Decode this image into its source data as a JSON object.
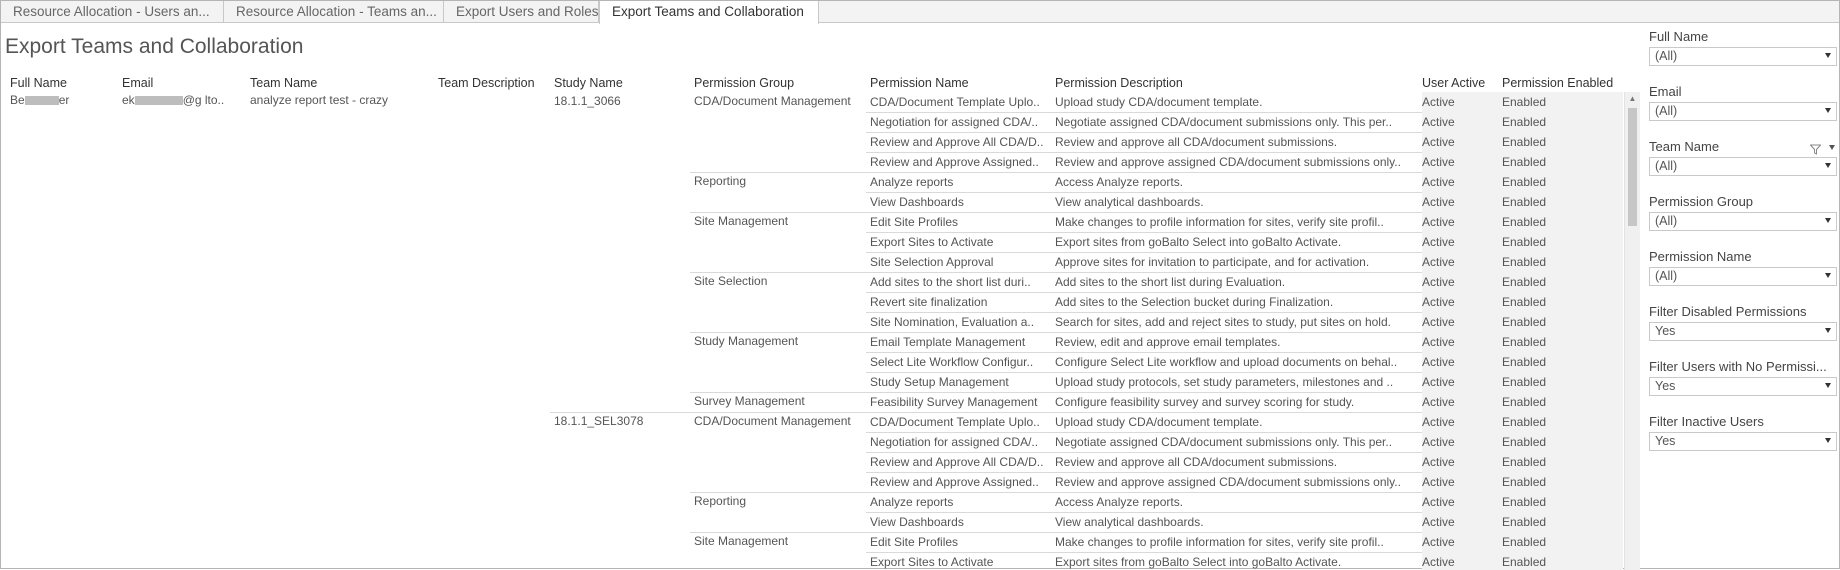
{
  "tabs": [
    {
      "label": "Resource Allocation - Users an...",
      "active": false
    },
    {
      "label": "Resource Allocation - Teams an...",
      "active": false
    },
    {
      "label": "Export Users and Roles",
      "active": false
    },
    {
      "label": "Export Teams and Collaboration",
      "active": true
    }
  ],
  "page_title": "Export Teams and Collaboration",
  "columns": [
    "Full Name",
    "Email",
    "Team Name",
    "Team Description",
    "Study Name",
    "Permission Group",
    "Permission Name",
    "Permission Description",
    "User Active",
    "Permission Enabled"
  ],
  "user": {
    "full_name_start": "Be",
    "full_name_end": "er",
    "email_start": "ek",
    "email_end": "@g   lto..",
    "team_name": "analyze report test - crazy",
    "team_description": ""
  },
  "studies": [
    {
      "name": "18.1.1_3066",
      "groups": [
        {
          "name": "CDA/Document Management",
          "rows": [
            {
              "perm": "CDA/Document Template Uplo..",
              "desc": "Upload study CDA/document template.",
              "active": "Active",
              "enabled": "Enabled"
            },
            {
              "perm": "Negotiation for assigned CDA/..",
              "desc": "Negotiate assigned CDA/document submissions only. This per..",
              "active": "Active",
              "enabled": "Enabled"
            },
            {
              "perm": "Review and Approve All CDA/D..",
              "desc": "Review and approve all CDA/document submissions.",
              "active": "Active",
              "enabled": "Enabled"
            },
            {
              "perm": "Review and Approve Assigned..",
              "desc": "Review and approve assigned CDA/document submissions only..",
              "active": "Active",
              "enabled": "Enabled"
            }
          ]
        },
        {
          "name": "Reporting",
          "rows": [
            {
              "perm": "Analyze reports",
              "desc": "Access Analyze reports.",
              "active": "Active",
              "enabled": "Enabled"
            },
            {
              "perm": "View Dashboards",
              "desc": "View analytical dashboards.",
              "active": "Active",
              "enabled": "Enabled"
            }
          ]
        },
        {
          "name": "Site Management",
          "rows": [
            {
              "perm": "Edit Site Profiles",
              "desc": "Make changes to profile information for sites, verify site profil..",
              "active": "Active",
              "enabled": "Enabled"
            },
            {
              "perm": "Export Sites to Activate",
              "desc": "Export sites from goBalto Select into goBalto Activate.",
              "active": "Active",
              "enabled": "Enabled"
            },
            {
              "perm": "Site Selection Approval",
              "desc": "Approve sites for invitation to participate, and for activation.",
              "active": "Active",
              "enabled": "Enabled"
            }
          ]
        },
        {
          "name": "Site Selection",
          "rows": [
            {
              "perm": "Add sites to the short list duri..",
              "desc": "Add sites to the short list during Evaluation.",
              "active": "Active",
              "enabled": "Enabled"
            },
            {
              "perm": "Revert site finalization",
              "desc": "Add sites to the Selection bucket during Finalization.",
              "active": "Active",
              "enabled": "Enabled"
            },
            {
              "perm": "Site Nomination, Evaluation a..",
              "desc": "Search for sites, add and reject sites to study, put sites on hold.",
              "active": "Active",
              "enabled": "Enabled"
            }
          ]
        },
        {
          "name": "Study Management",
          "rows": [
            {
              "perm": "Email Template Management",
              "desc": "Review, edit and approve email templates.",
              "active": "Active",
              "enabled": "Enabled"
            },
            {
              "perm": "Select Lite Workflow Configur..",
              "desc": "Configure Select Lite workflow and upload documents on behal..",
              "active": "Active",
              "enabled": "Enabled"
            },
            {
              "perm": "Study Setup Management",
              "desc": "Upload study protocols, set study parameters, milestones and ..",
              "active": "Active",
              "enabled": "Enabled"
            }
          ]
        },
        {
          "name": "Survey Management",
          "rows": [
            {
              "perm": "Feasibility Survey Management",
              "desc": "Configure feasibility survey and survey scoring for study.",
              "active": "Active",
              "enabled": "Enabled"
            }
          ]
        }
      ]
    },
    {
      "name": "18.1.1_SEL3078",
      "groups": [
        {
          "name": "CDA/Document Management",
          "rows": [
            {
              "perm": "CDA/Document Template Uplo..",
              "desc": "Upload study CDA/document template.",
              "active": "Active",
              "enabled": "Enabled"
            },
            {
              "perm": "Negotiation for assigned CDA/..",
              "desc": "Negotiate assigned CDA/document submissions only. This per..",
              "active": "Active",
              "enabled": "Enabled"
            },
            {
              "perm": "Review and Approve All CDA/D..",
              "desc": "Review and approve all CDA/document submissions.",
              "active": "Active",
              "enabled": "Enabled"
            },
            {
              "perm": "Review and Approve Assigned..",
              "desc": "Review and approve assigned CDA/document submissions only..",
              "active": "Active",
              "enabled": "Enabled"
            }
          ]
        },
        {
          "name": "Reporting",
          "rows": [
            {
              "perm": "Analyze reports",
              "desc": "Access Analyze reports.",
              "active": "Active",
              "enabled": "Enabled"
            },
            {
              "perm": "View Dashboards",
              "desc": "View analytical dashboards.",
              "active": "Active",
              "enabled": "Enabled"
            }
          ]
        },
        {
          "name": "Site Management",
          "rows": [
            {
              "perm": "Edit Site Profiles",
              "desc": "Make changes to profile information for sites, verify site profil..",
              "active": "Active",
              "enabled": "Enabled"
            },
            {
              "perm": "Export Sites to Activate",
              "desc": "Export sites from goBalto Select into goBalto Activate.",
              "active": "Active",
              "enabled": "Enabled"
            }
          ]
        }
      ]
    }
  ],
  "filters": [
    {
      "label": "Full Name",
      "value": "(All)",
      "funnel": false
    },
    {
      "label": "Email",
      "value": "(All)",
      "funnel": false
    },
    {
      "label": "Team Name",
      "value": "(All)",
      "funnel": true
    },
    {
      "label": "Permission Group",
      "value": "(All)",
      "funnel": false
    },
    {
      "label": "Permission Name",
      "value": "(All)",
      "funnel": false
    },
    {
      "label": "Filter Disabled Permissions",
      "value": "Yes",
      "funnel": false
    },
    {
      "label": "Filter Users with No Permissi...",
      "value": "Yes",
      "funnel": false
    },
    {
      "label": "Filter Inactive Users",
      "value": "Yes",
      "funnel": false
    }
  ],
  "colors": {
    "row_shade": "#f2f2f2",
    "divider": "#d9d9d9",
    "text": "#555555"
  }
}
